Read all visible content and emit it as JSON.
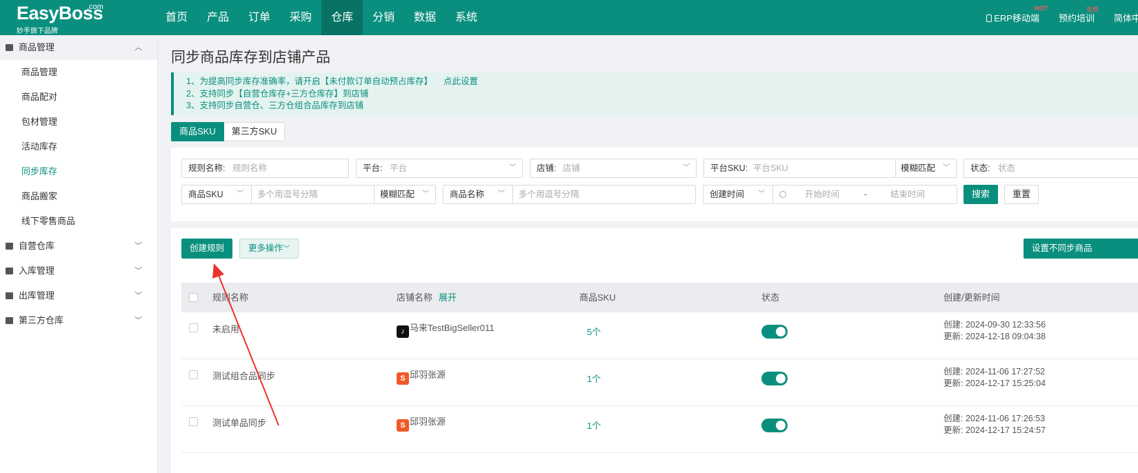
{
  "topbar": {
    "logo": "EasyBoss",
    "logo_com": ".com",
    "logo_sub": "妙手旗下品牌",
    "nav": [
      "首页",
      "产品",
      "订单",
      "采购",
      "仓库",
      "分销",
      "数据",
      "系统"
    ],
    "active_nav": "仓库",
    "erp_mobile": "ERP移动端",
    "erp_badge": "HOT",
    "training": "预约培训",
    "training_badge": "免费",
    "language": "简体中"
  },
  "sidebar": {
    "groups": [
      {
        "label": "商品管理",
        "expanded": true,
        "items": [
          "商品管理",
          "商品配对",
          "包材管理",
          "活动库存",
          "同步库存",
          "商品搬家",
          "线下零售商品"
        ]
      },
      {
        "label": "自营仓库",
        "expanded": false
      },
      {
        "label": "入库管理",
        "expanded": false
      },
      {
        "label": "出库管理",
        "expanded": false
      },
      {
        "label": "第三方仓库",
        "expanded": false
      }
    ],
    "active_item": "同步库存"
  },
  "page": {
    "title": "同步商品库存到店铺产品",
    "notice": [
      "1、为提高同步库存准确率，请开启【未付款订单自动预占库存】",
      "2、支持同步【自营仓库存+三方仓库存】到店铺",
      "3、支持同步自营仓、三方仓组合品库存到店铺"
    ],
    "notice_link": "点此设置",
    "tabs": [
      "商品SKU",
      "第三方SKU"
    ]
  },
  "filters": {
    "rule_name_label": "规则名称:",
    "rule_name_placeholder": "规则名称",
    "platform_label": "平台:",
    "platform_placeholder": "平台",
    "store_label": "店铺:",
    "store_placeholder": "店铺",
    "platform_sku_label": "平台SKU:",
    "platform_sku_placeholder": "平台SKU",
    "fuzzy_match": "模糊匹配",
    "status_label": "状态:",
    "status_placeholder": "状态",
    "sku_select": "商品SKU",
    "multi_placeholder": "多个用逗号分隔",
    "fuzzy_match_2": "模糊匹配",
    "name_select": "商品名称",
    "multi_placeholder_2": "多个用逗号分隔",
    "time_select": "创建时间",
    "start_time": "开始时间",
    "time_sep": "-",
    "end_time": "结束时间",
    "search": "搜索",
    "reset": "重置"
  },
  "actions": {
    "create_rule": "创建规则",
    "more_actions": "更多操作",
    "right_button": "设置不同步商品"
  },
  "table": {
    "columns": [
      "规则名称",
      "店铺名称",
      "商品SKU",
      "状态",
      "创建/更新时间"
    ],
    "expand": "展开",
    "rows": [
      {
        "name": "未启用",
        "store": "马来TestBigSeller011",
        "store_icon": "tiktok-icon",
        "sku": "5个",
        "enabled": true,
        "created_label": "创建:",
        "created": "2024-09-30 12:33:56",
        "updated_label": "更新:",
        "updated": "2024-12-18 09:04:38"
      },
      {
        "name": "测试组合品同步",
        "store": "邱羽张源",
        "store_icon": "shopee-icon",
        "sku": "1个",
        "enabled": true,
        "created_label": "创建:",
        "created": "2024-11-06 17:27:52",
        "updated_label": "更新:",
        "updated": "2024-12-17 15:25:04"
      },
      {
        "name": "测试单品同步",
        "store": "邱羽张源",
        "store_icon": "shopee-icon",
        "sku": "1个",
        "enabled": true,
        "created_label": "创建:",
        "created": "2024-11-06 17:26:53",
        "updated_label": "更新:",
        "updated": "2024-12-17 15:24:57"
      }
    ]
  },
  "colors": {
    "primary": "#0a8f7e",
    "annotation_arrow": "#e8332a"
  }
}
